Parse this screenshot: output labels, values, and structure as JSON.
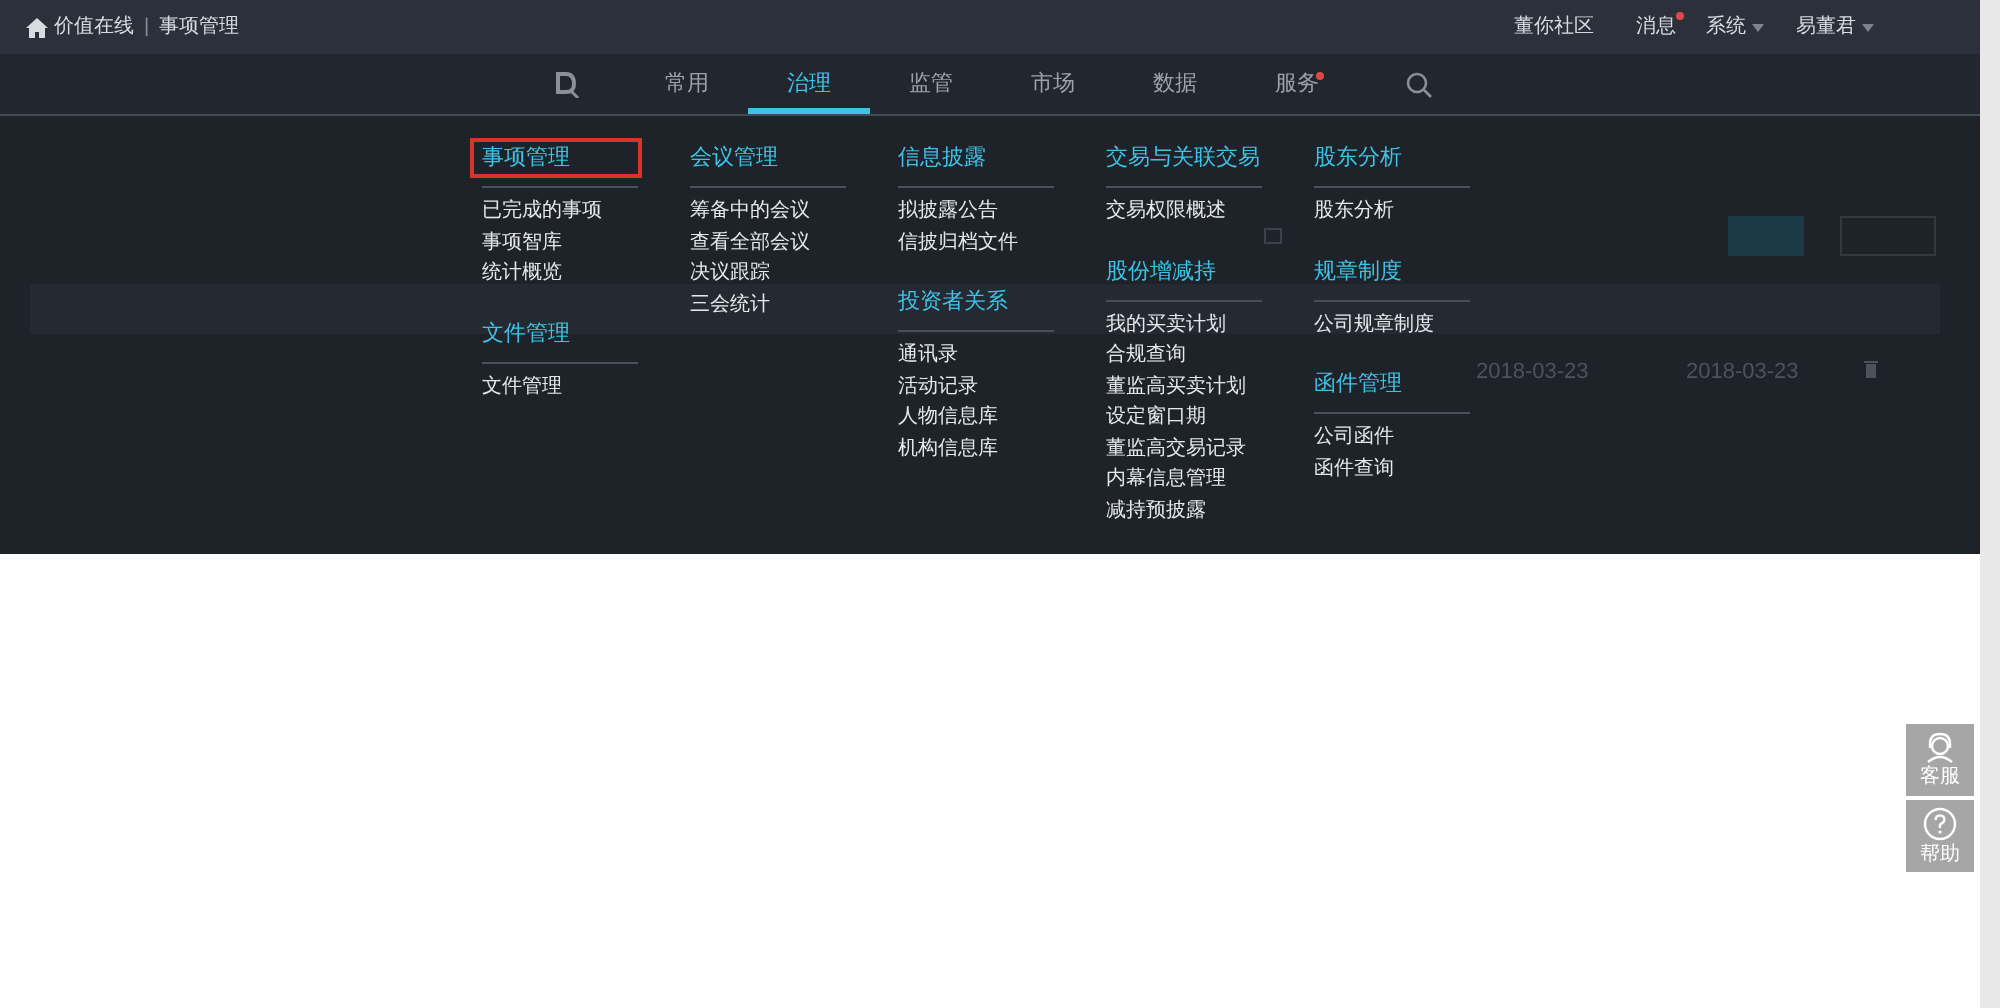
{
  "top_bar": {
    "site": "价值在线",
    "separator": "|",
    "page": "事项管理",
    "links": [
      {
        "label": "董你社区",
        "badge": false,
        "dropdown": false
      },
      {
        "label": "消息",
        "badge": true,
        "dropdown": false
      },
      {
        "label": "系统",
        "badge": false,
        "dropdown": true
      },
      {
        "label": "易董君",
        "badge": false,
        "dropdown": true
      }
    ]
  },
  "nav": {
    "items": [
      {
        "kind": "logo"
      },
      {
        "kind": "text",
        "label": "常用",
        "selected": false,
        "badge": false
      },
      {
        "kind": "text",
        "label": "治理",
        "selected": true,
        "badge": false
      },
      {
        "kind": "text",
        "label": "监管",
        "selected": false,
        "badge": false
      },
      {
        "kind": "text",
        "label": "市场",
        "selected": false,
        "badge": false
      },
      {
        "kind": "text",
        "label": "数据",
        "selected": false,
        "badge": false
      },
      {
        "kind": "text",
        "label": "服务",
        "selected": false,
        "badge": true
      },
      {
        "kind": "search"
      }
    ]
  },
  "menu": {
    "columns": [
      [
        {
          "title": "事项管理",
          "highlighted": true,
          "items": [
            "已完成的事项",
            "事项智库",
            "统计概览"
          ]
        },
        {
          "title": "文件管理",
          "highlighted": false,
          "items": [
            "文件管理"
          ]
        }
      ],
      [
        {
          "title": "会议管理",
          "highlighted": false,
          "items": [
            "筹备中的会议",
            "查看全部会议",
            "决议跟踪",
            "三会统计"
          ]
        }
      ],
      [
        {
          "title": "信息披露",
          "highlighted": false,
          "items": [
            "拟披露公告",
            "信披归档文件"
          ]
        },
        {
          "title": "投资者关系",
          "highlighted": false,
          "items": [
            "通讯录",
            "活动记录",
            "人物信息库",
            "机构信息库"
          ]
        }
      ],
      [
        {
          "title": "交易与关联交易",
          "highlighted": false,
          "items": [
            "交易权限概述"
          ]
        },
        {
          "title": "股份增减持",
          "highlighted": false,
          "items": [
            "我的买卖计划",
            "合规查询",
            "董监高买卖计划",
            "设定窗口期",
            "董监高交易记录",
            "内幕信息管理",
            "减持预披露"
          ]
        }
      ],
      [
        {
          "title": "股东分析",
          "highlighted": false,
          "items": [
            "股东分析"
          ]
        },
        {
          "title": "规章制度",
          "highlighted": false,
          "items": [
            "公司规章制度"
          ]
        },
        {
          "title": "函件管理",
          "highlighted": false,
          "items": [
            "公司函件",
            "函件查询"
          ]
        }
      ]
    ]
  },
  "background_table": {
    "row": [
      "2018-03-23",
      "2018-03-23"
    ]
  },
  "float_buttons": [
    {
      "kind": "service",
      "label": "客服"
    },
    {
      "kind": "help",
      "label": "帮助"
    }
  ]
}
